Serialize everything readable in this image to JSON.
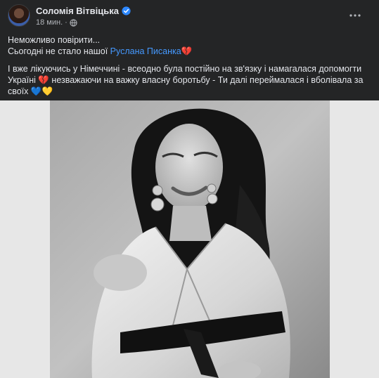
{
  "post": {
    "author": "Соломія Вітвіцька",
    "time": "18 мин.",
    "line1": "Неможливо повірити...",
    "line2_prefix": "Сьогодні не стало нашої ",
    "mention": "Руслана Писанка",
    "line2_suffix": "💔",
    "para2": "І вже лікуючись у Німеччині - всеодно була постійно на зв'язку і намагалася допомогти Україні 💔 незважаючи на важку власну боротьбу - Ти далі переймалася і вболівала за своїх 💙💛"
  },
  "icons": {
    "verified": "verified-badge-icon",
    "privacy": "globe-icon",
    "menu": "more-horizontal-icon"
  },
  "colors": {
    "background": "#242526",
    "text": "#e4e6eb",
    "secondary_text": "#b0b3b8",
    "link": "#4599ff",
    "verified": "#2d88ff"
  }
}
